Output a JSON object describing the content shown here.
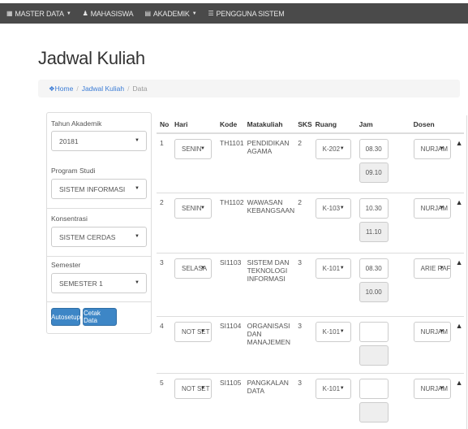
{
  "navbar": {
    "items": [
      {
        "label": "MASTER DATA",
        "icon": "grid-icon"
      },
      {
        "label": "MAHASISWA",
        "icon": "users-icon"
      },
      {
        "label": "AKADEMIK",
        "icon": "book-icon"
      },
      {
        "label": "PENGGUNA SISTEM",
        "icon": "list-icon"
      }
    ]
  },
  "page": {
    "title": "Jadwal Kuliah"
  },
  "breadcrumb": {
    "home": "Home",
    "jadwal": "Jadwal Kuliah",
    "current": "Data",
    "sep": "/"
  },
  "filters": {
    "tahun_label": "Tahun Akademik",
    "tahun_value": "20181",
    "prodi_label": "Program Studi",
    "prodi_value": "SISTEM INFORMASI",
    "konsentrasi_label": "Konsentrasi",
    "konsentrasi_value": "SISTEM CERDAS",
    "semester_label": "Semester",
    "semester_value": "SEMESTER 1",
    "autosetup_label": "Autosetup",
    "cetak_label": "Cetak Data"
  },
  "table": {
    "headers": {
      "no": "No",
      "hari": "Hari",
      "kode": "Kode",
      "matakuliah": "Matakuliah",
      "sks": "SKS",
      "ruang": "Ruang",
      "jam": "Jam",
      "dosen": "Dosen"
    },
    "rows": [
      {
        "no": "1",
        "hari": "SENIN",
        "kode": "TH1101",
        "matakuliah": "PENDIDIKAN AGAMA",
        "sks": "2",
        "ruang": "K-202",
        "jam_mulai": "08.30",
        "jam_selesai": "09.10",
        "dosen": "NURJAM"
      },
      {
        "no": "2",
        "hari": "SENIN",
        "kode": "TH1102",
        "matakuliah": "WAWASAN KEBANGSAAN",
        "sks": "2",
        "ruang": "K-103",
        "jam_mulai": "10.30",
        "jam_selesai": "11.10",
        "dosen": "NURJAM"
      },
      {
        "no": "3",
        "hari": "SELASA",
        "kode": "SI1103",
        "matakuliah": "SISTEM DAN TEKNOLOGI INFORMASI",
        "sks": "3",
        "ruang": "K-101",
        "jam_mulai": "08.30",
        "jam_selesai": "10.00",
        "dosen": "ARIE RAF"
      },
      {
        "no": "4",
        "hari": "NOT SET",
        "kode": "SI1104",
        "matakuliah": "ORGANISASI DAN MANAJEMEN",
        "sks": "3",
        "ruang": "K-101",
        "jam_mulai": "",
        "jam_selesai": "",
        "dosen": "NURJAM"
      },
      {
        "no": "5",
        "hari": "NOT SET",
        "kode": "SI1105",
        "matakuliah": "PANGKALAN DATA",
        "sks": "3",
        "ruang": "K-101",
        "jam_mulai": "",
        "jam_selesai": "",
        "dosen": "NURJAM"
      }
    ]
  }
}
